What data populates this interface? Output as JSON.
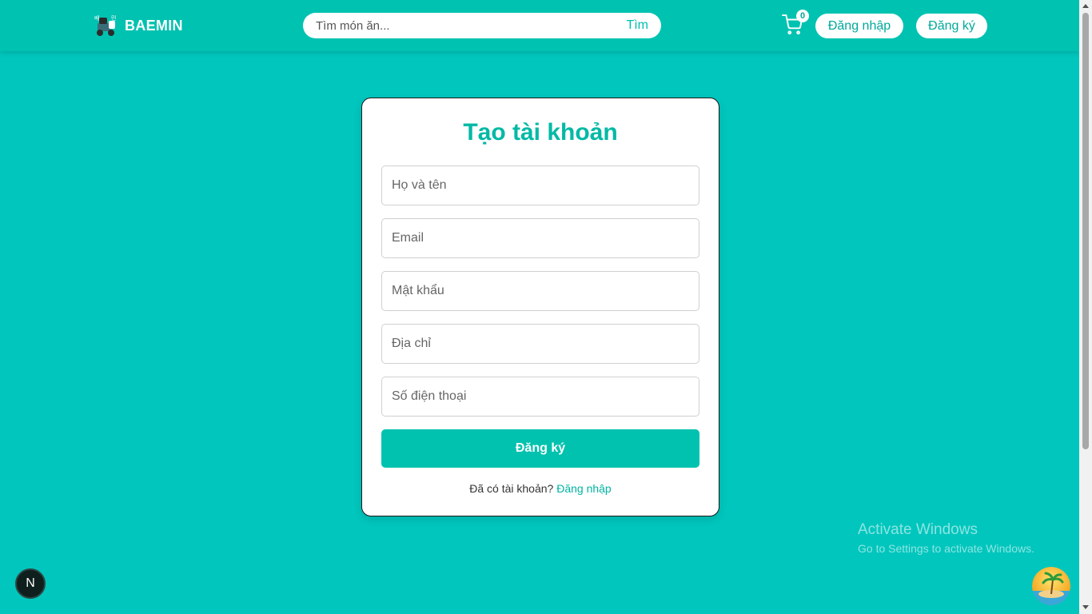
{
  "header": {
    "brand": "BAEMIN",
    "search": {
      "placeholder": "Tìm món ăn...",
      "button_label": "Tìm"
    },
    "cart_count": "0",
    "login_label": "Đăng nhập",
    "register_label": "Đăng ký"
  },
  "form": {
    "title": "Tạo tài khoản",
    "fields": [
      {
        "placeholder": "Họ và tên"
      },
      {
        "placeholder": "Email"
      },
      {
        "placeholder": "Mật khẩu"
      },
      {
        "placeholder": "Địa chỉ"
      },
      {
        "placeholder": "Số điện thoại"
      }
    ],
    "submit_label": "Đăng ký",
    "footer_text": "Đã có tài khoản?",
    "footer_link": "Đăng nhập"
  },
  "watermark": {
    "title": "Activate Windows",
    "subtitle": "Go to Settings to activate Windows."
  },
  "dev_badge": "N",
  "colors": {
    "background": "#00c6bd",
    "header": "#00c2b1",
    "accent": "#00b9a5",
    "button": "#00c2ae"
  },
  "icons": {
    "logo": "baemin-scooter-logo",
    "cart": "shopping-cart-icon"
  }
}
